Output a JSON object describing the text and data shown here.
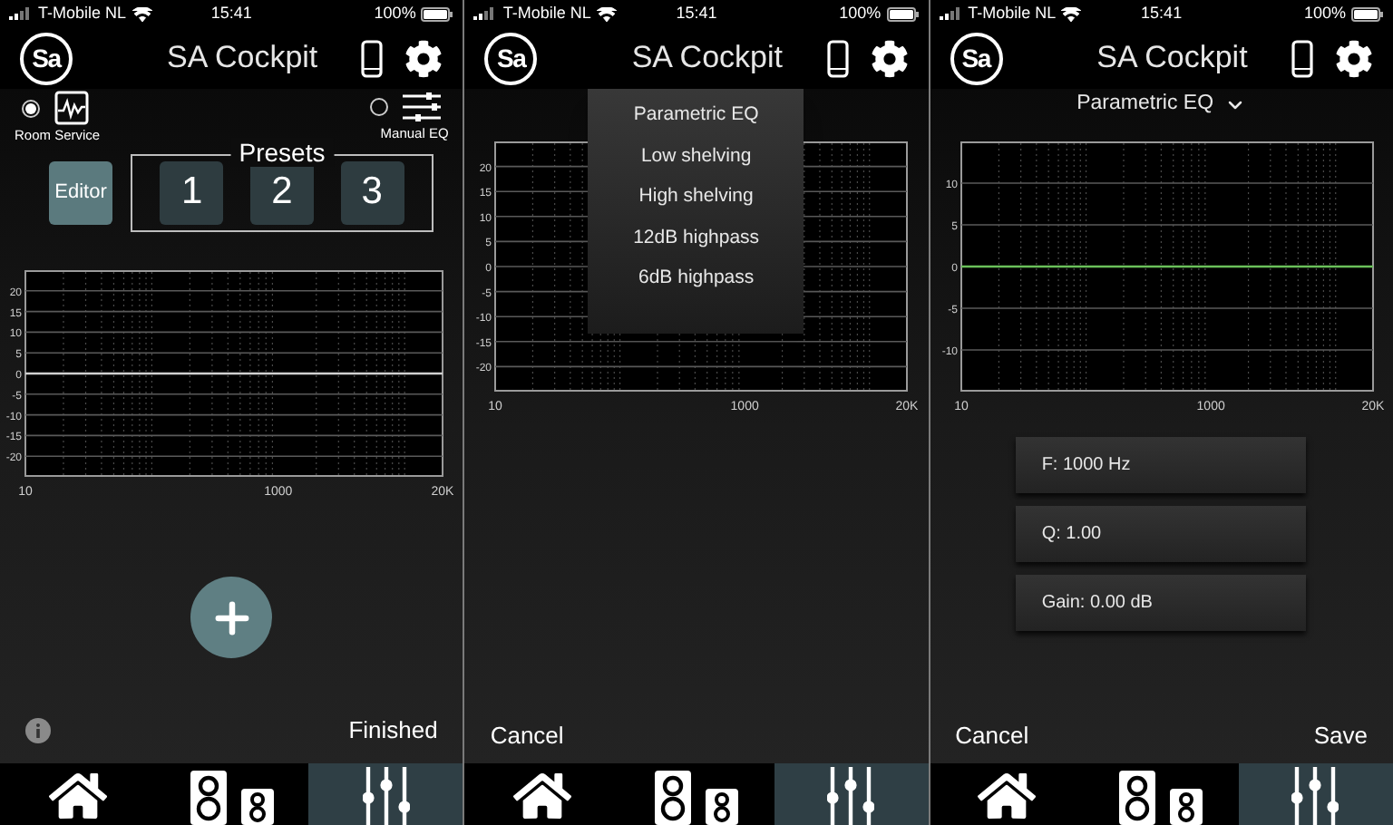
{
  "screens": [
    {
      "kind": "presets",
      "status_bar": {
        "carrier": "T-Mobile NL",
        "time": "15:41",
        "battery": "100%"
      },
      "header": {
        "logo": "Sa",
        "title": "SA Cockpit"
      },
      "modes": [
        {
          "label": "Room Service",
          "kind": "wave",
          "selected": true
        },
        {
          "label": "Manual EQ",
          "kind": "sliders",
          "selected": false
        }
      ],
      "presets": {
        "editor": "Editor",
        "title": "Presets",
        "items": [
          "1",
          "2",
          "3"
        ]
      },
      "chart_data": {
        "type": "line",
        "categories": [
          "10",
          null,
          null,
          null,
          null,
          null,
          null,
          null,
          null,
          null,
          null,
          null,
          null,
          null,
          null,
          null,
          null,
          null,
          null,
          null,
          "1000",
          null,
          null,
          null,
          null,
          null,
          null,
          null,
          null,
          null,
          null,
          null,
          null,
          "20K"
        ],
        "series": [
          {
            "color": "#d0d0d0",
            "values": [
              0,
              0,
              0,
              0,
              0,
              0,
              0,
              0,
              0,
              0,
              0,
              0,
              0,
              0,
              0,
              0,
              0,
              0,
              0,
              0,
              0,
              0,
              0,
              0,
              0,
              0,
              0,
              0,
              0,
              0,
              0,
              0,
              0,
              0
            ]
          }
        ],
        "ylim": [
          -25,
          25
        ],
        "yticks": [
          20,
          15,
          10,
          5,
          0,
          -5,
          -10,
          -15,
          -20
        ],
        "grid": true
      },
      "footer": {
        "right": "Finished"
      },
      "tabs": [
        {
          "kind": "home",
          "selected": false
        },
        {
          "kind": "speakers",
          "selected": false
        },
        {
          "kind": "mixer",
          "selected": true
        }
      ]
    },
    {
      "kind": "menu",
      "status_bar": {
        "carrier": "T-Mobile NL",
        "time": "15:41",
        "battery": "100%"
      },
      "header": {
        "logo": "Sa",
        "title": "SA Cockpit"
      },
      "menu": [
        "Parametric EQ",
        "Low shelving",
        "High shelving",
        "12dB highpass",
        "6dB highpass"
      ],
      "chart_data": {
        "type": "line",
        "categories": [
          "10",
          null,
          null,
          null,
          null,
          null,
          null,
          null,
          null,
          null,
          null,
          null,
          null,
          null,
          null,
          null,
          null,
          null,
          null,
          null,
          "1000",
          null,
          null,
          null,
          null,
          null,
          null,
          null,
          null,
          null,
          null,
          null,
          null,
          "20K"
        ],
        "ylim": [
          -25,
          25
        ],
        "yticks": [
          20,
          15,
          10,
          5,
          0,
          -5,
          -10,
          -15,
          -20
        ],
        "grid": true
      },
      "footer": {
        "left": "Cancel"
      },
      "tabs": [
        {
          "kind": "home",
          "selected": false
        },
        {
          "kind": "speakers",
          "selected": false
        },
        {
          "kind": "mixer",
          "selected": true
        }
      ]
    },
    {
      "kind": "filter",
      "status_bar": {
        "carrier": "T-Mobile NL",
        "time": "15:41",
        "battery": "100%"
      },
      "header": {
        "logo": "Sa",
        "title": "SA Cockpit"
      },
      "filter_type": "Parametric EQ",
      "chart_data": {
        "type": "line",
        "categories": [
          "10",
          null,
          null,
          null,
          null,
          null,
          null,
          null,
          null,
          null,
          null,
          null,
          null,
          null,
          null,
          null,
          null,
          null,
          null,
          null,
          "1000",
          null,
          null,
          null,
          null,
          null,
          null,
          null,
          null,
          null,
          null,
          null,
          null,
          "20K"
        ],
        "series": [
          {
            "color": "#6ac05a",
            "values": [
              0,
              0,
              0,
              0,
              0,
              0,
              0,
              0,
              0,
              0,
              0,
              0,
              0,
              0,
              0,
              0,
              0,
              0,
              0,
              0,
              0,
              0,
              0,
              0,
              0,
              0,
              0,
              0,
              0,
              0,
              0,
              0,
              0,
              0
            ]
          }
        ],
        "ylim": [
          -15,
          15
        ],
        "yticks": [
          10,
          5,
          0,
          -5,
          -10
        ],
        "grid": true
      },
      "params": [
        "F: 1000 Hz",
        "Q: 1.00",
        "Gain: 0.00 dB"
      ],
      "footer": {
        "left": "Cancel",
        "right": "Save"
      },
      "tabs": [
        {
          "kind": "home",
          "selected": false
        },
        {
          "kind": "speakers",
          "selected": false
        },
        {
          "kind": "mixer",
          "selected": true
        }
      ]
    }
  ]
}
